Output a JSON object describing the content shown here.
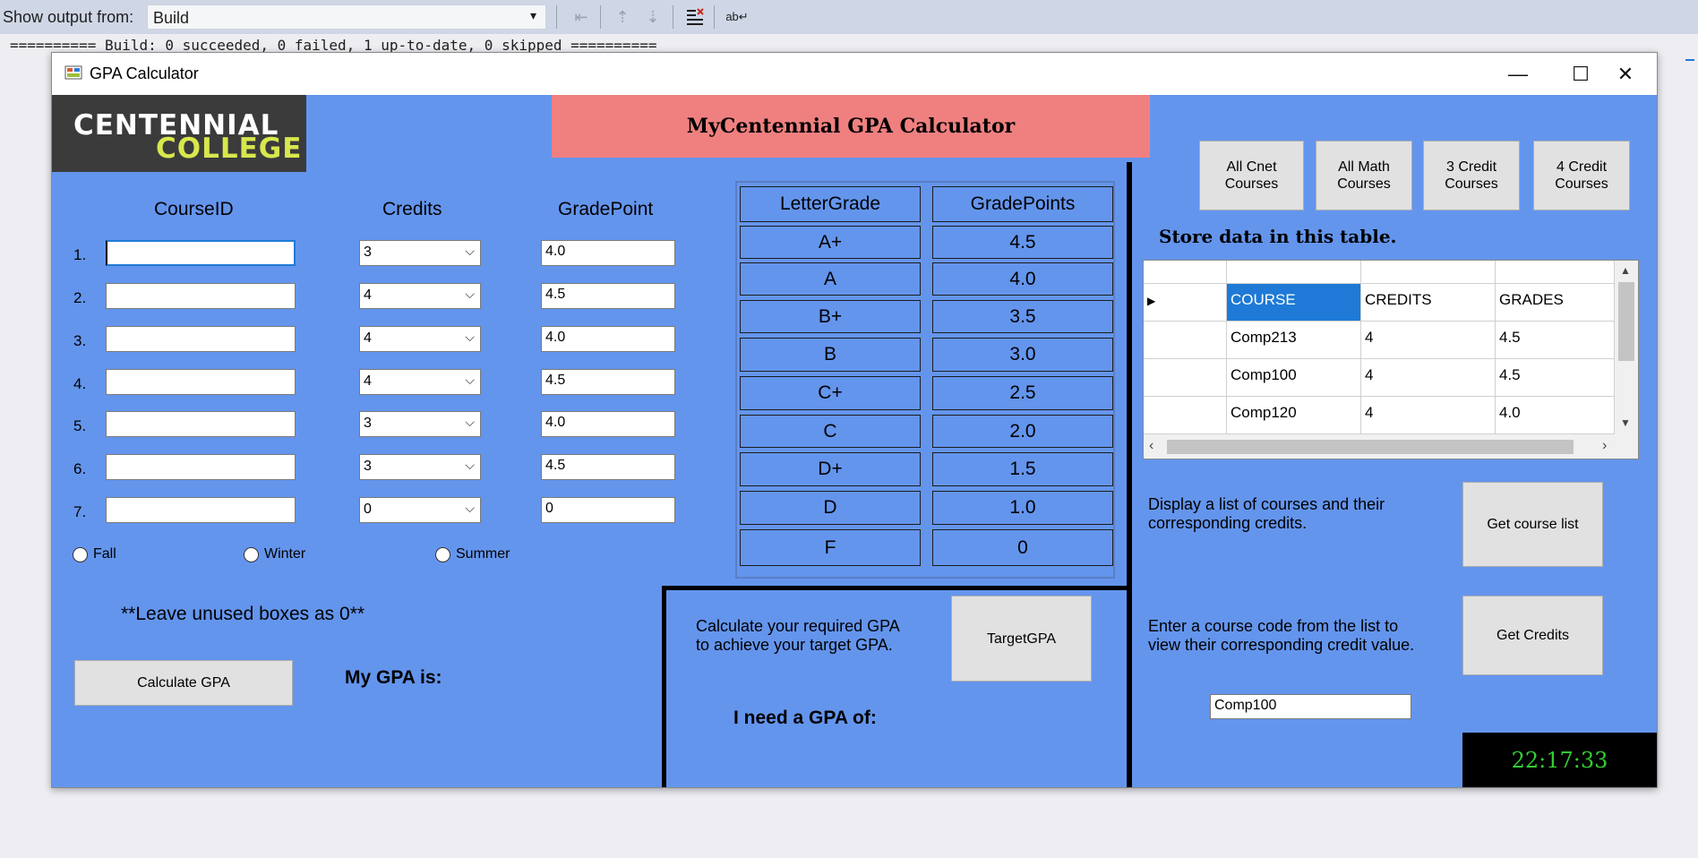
{
  "output_pane": {
    "label": "Show output from:",
    "source": "Build",
    "build_line": "========== Build: 0 succeeded, 0 failed, 1 up-to-date, 0 skipped =========="
  },
  "window": {
    "title": "GPA Calculator",
    "minimize": "—",
    "maximize": "☐",
    "close": "✕"
  },
  "logo": {
    "line1": "CENTENNIAL",
    "line2": "COLLEGE"
  },
  "header": "MyCentennial GPA Calculator",
  "courses": {
    "headers": {
      "course_id": "CourseID",
      "credits": "Credits",
      "grade_point": "GradePoint"
    },
    "rows": [
      {
        "num": "1.",
        "course_id": "",
        "credits": "3",
        "grade_point": "4.0"
      },
      {
        "num": "2.",
        "course_id": "",
        "credits": "4",
        "grade_point": "4.5"
      },
      {
        "num": "3.",
        "course_id": "",
        "credits": "4",
        "grade_point": "4.0"
      },
      {
        "num": "4.",
        "course_id": "",
        "credits": "4",
        "grade_point": "4.5"
      },
      {
        "num": "5.",
        "course_id": "",
        "credits": "3",
        "grade_point": "4.0"
      },
      {
        "num": "6.",
        "course_id": "",
        "credits": "3",
        "grade_point": "4.5"
      },
      {
        "num": "7.",
        "course_id": "",
        "credits": "0",
        "grade_point": "0"
      }
    ]
  },
  "terms": {
    "fall": "Fall",
    "winter": "Winter",
    "summer": "Summer"
  },
  "note": "**Leave unused boxes as 0**",
  "calculate_button": "Calculate GPA",
  "my_gpa_label": "My GPA is:",
  "grade_table": {
    "headers": [
      "LetterGrade",
      "GradePoints"
    ],
    "rows": [
      [
        "A+",
        "4.5"
      ],
      [
        "A",
        "4.0"
      ],
      [
        "B+",
        "3.5"
      ],
      [
        "B",
        "3.0"
      ],
      [
        "C+",
        "2.5"
      ],
      [
        "C",
        "2.0"
      ],
      [
        "D+",
        "1.5"
      ],
      [
        "D",
        "1.0"
      ],
      [
        "F",
        "0"
      ]
    ]
  },
  "target": {
    "description_line1": "Calculate your required GPA",
    "description_line2": "to achieve your target GPA.",
    "button": "TargetGPA",
    "need_label": "I need a GPA of:"
  },
  "filter_buttons": [
    {
      "line1": "All Cnet",
      "line2": "Courses"
    },
    {
      "line1": "All Math",
      "line2": "Courses"
    },
    {
      "line1": "3 Credit",
      "line2": "Courses"
    },
    {
      "line1": "4 Credit",
      "line2": "Courses"
    }
  ],
  "store_label": "Store data in this table.",
  "data_grid": {
    "columns": [
      "COURSE",
      "CREDITS",
      "GRADES"
    ],
    "rows": [
      [
        "Comp213",
        "4",
        "4.5"
      ],
      [
        "Comp100",
        "4",
        "4.5"
      ],
      [
        "Comp120",
        "4",
        "4.0"
      ]
    ]
  },
  "course_list": {
    "line1": "Display a list of courses and their",
    "line2": "corresponding credits.",
    "button": "Get course list"
  },
  "get_credits": {
    "line1": "Enter a course code from the list to",
    "line2": "view their corresponding credit value.",
    "button": "Get Credits",
    "input_value": "Comp100"
  },
  "clock": "22:17:33"
}
